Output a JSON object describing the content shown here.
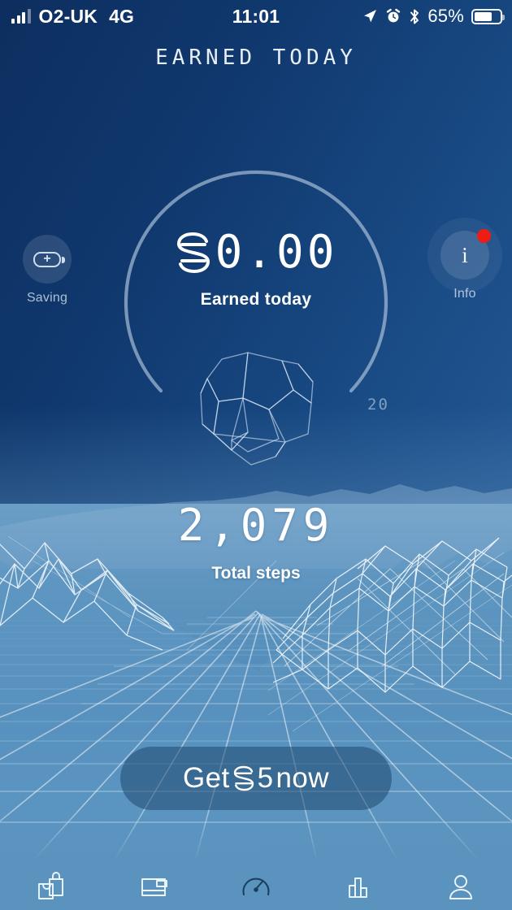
{
  "status_bar": {
    "carrier": "O2-UK",
    "network": "4G",
    "time": "11:01",
    "battery_percent": "65%",
    "icons": [
      "signal-bars-icon",
      "location-arrow-icon",
      "alarm-clock-icon",
      "bluetooth-icon",
      "battery-icon"
    ]
  },
  "header": {
    "title": "EARNED  TODAY"
  },
  "gauge": {
    "currency_symbol": "sweatcoin-symbol",
    "amount": "0.00",
    "caption": "Earned today",
    "max_label": "20",
    "progress_percent": 0,
    "polyhedron": "dodecahedron-wireframe"
  },
  "left_button": {
    "icon": "battery-plus-icon",
    "label": "Saving"
  },
  "right_button": {
    "icon": "info-icon",
    "label": "Info",
    "badge": "notification-dot",
    "badge_color": "#f01c14"
  },
  "steps": {
    "value": "2,079",
    "caption": "Total steps"
  },
  "cta": {
    "prefix": "Get",
    "symbol": "sweatcoin-symbol",
    "amount": "5",
    "suffix": "now",
    "full_label": "Get S5 now"
  },
  "tabbar": {
    "active_index": 2,
    "items": [
      {
        "name": "shop",
        "icon": "shopping-bag-icon"
      },
      {
        "name": "wallet",
        "icon": "wallet-icon"
      },
      {
        "name": "activity",
        "icon": "speedometer-icon"
      },
      {
        "name": "stats",
        "icon": "bar-chart-icon"
      },
      {
        "name": "profile",
        "icon": "person-icon"
      }
    ]
  },
  "colors": {
    "bg_top": "#0f3063",
    "bg_top_right": "#1a4c86",
    "terrain": "#5a93be",
    "tabbar": "#5a93be",
    "accent_red": "#f01c14",
    "text_primary": "#ffffff"
  }
}
